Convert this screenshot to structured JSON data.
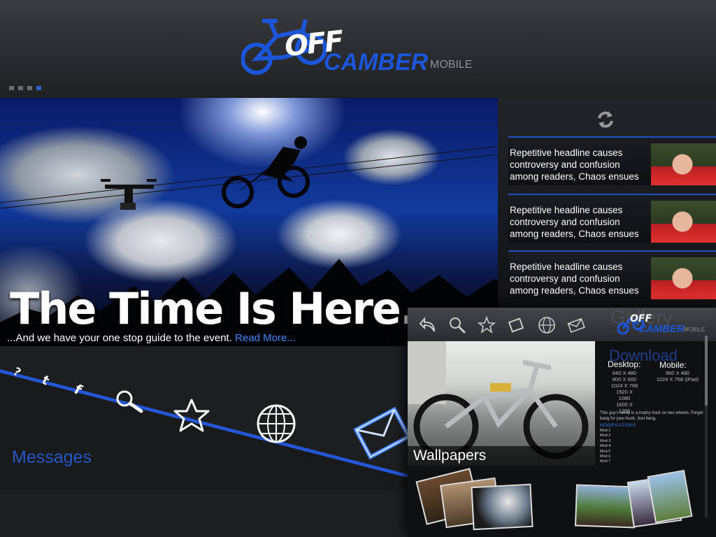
{
  "header": {
    "logo": {
      "off": "OFF",
      "camber": "CAMBER",
      "mobile": "MOBILE"
    },
    "page_indicator": {
      "count": 4,
      "active_index": 3
    }
  },
  "hero": {
    "headline": "The Time Is Here.",
    "subline": "...And we have your one stop guide to the event.",
    "read_more": "Read More..."
  },
  "news": {
    "refresh_icon": "refresh-icon",
    "items": [
      {
        "headline": "Repetitive headline causes controversy and confusion among readers, Chaos ensues"
      },
      {
        "headline": "Repetitive headline causes controversy and confusion among readers, Chaos ensues"
      },
      {
        "headline": "Repetitive headline causes controversy and confusion among readers, Chaos ensues"
      }
    ]
  },
  "nav": {
    "icons": [
      "question-icon",
      "twitter-icon",
      "facebook-icon",
      "search-icon",
      "star-icon",
      "globe-icon",
      "mail-icon"
    ],
    "selected_label": "Messages"
  },
  "gallery": {
    "ghost_title": "Gallery",
    "toolbar_icons": [
      "back-icon",
      "search-icon",
      "star-icon",
      "tag-icon",
      "globe-icon",
      "mail-icon"
    ],
    "logo": {
      "off": "OFF",
      "camber": "CAMBER",
      "mobile": "MOBILE"
    },
    "wallpapers_label": "Wallpapers",
    "download": {
      "title": "Download",
      "desktop_label": "Desktop:",
      "desktop_sizes": [
        "640 X 480",
        "800 X 600",
        "1024 X 768",
        "1920 X 1080",
        "1600 X 1200"
      ],
      "mobile_label": "Mobile:",
      "mobile_sizes": [
        "960 X 480",
        "1024 X 768 (iPad)"
      ],
      "description": "This guy's setup is a trophy truck on two wheels. Forget bang for your buck. Just bang.",
      "modifications_label": "MODIFICATIONS",
      "mods": [
        "Mod 1",
        "Mod 2",
        "Mod 3",
        "Mod 4",
        "Mod 5",
        "Mod 6",
        "Mod 7"
      ]
    }
  },
  "colors": {
    "accent_blue": "#1f4fc9",
    "link_blue": "#3f86ff",
    "background": "#1d1e20"
  }
}
